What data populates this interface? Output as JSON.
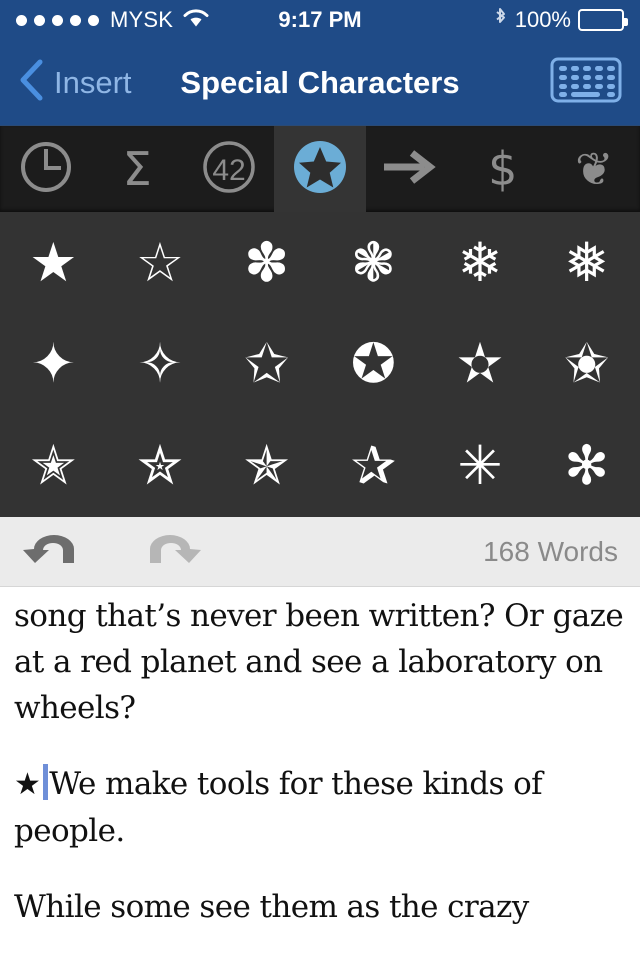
{
  "status_bar": {
    "signal_dots": 5,
    "carrier": "MYSK",
    "wifi_icon": "wifi-icon",
    "time": "9:17 PM",
    "bluetooth_icon": "bluetooth-icon",
    "battery_percent": "100%",
    "battery_icon": "battery-full-icon"
  },
  "nav_bar": {
    "back_icon": "chevron-left-icon",
    "back_label": "Insert",
    "title": "Special Characters",
    "keyboard_button_icon": "keyboard-icon",
    "bg_color": "#1f4b87",
    "back_label_color": "#8fb6e5"
  },
  "tab_bar": {
    "selected_index": 3,
    "selected_bg": "#343434",
    "bg_color": "#1c1c1c",
    "icon_color": "#8c8c8c",
    "accent_color": "#6badd6",
    "tabs": [
      {
        "name": "recent",
        "icon": "clock-icon",
        "glyph": ""
      },
      {
        "name": "math",
        "icon": "sigma-icon",
        "glyph": "Σ"
      },
      {
        "name": "numbers",
        "icon": "circled-42-icon",
        "glyph": "42"
      },
      {
        "name": "stars",
        "icon": "circled-star-icon",
        "glyph": "★"
      },
      {
        "name": "arrows",
        "icon": "arrow-right-icon",
        "glyph": "→"
      },
      {
        "name": "currency",
        "icon": "dollar-icon",
        "glyph": "$"
      },
      {
        "name": "ornaments",
        "icon": "floral-heart-icon",
        "glyph": "❦"
      }
    ]
  },
  "char_grid": {
    "bg_color": "#333333",
    "glyph_color": "#ffffff",
    "columns": 6,
    "rows": 3,
    "characters": [
      {
        "name": "black-star",
        "glyph": "★"
      },
      {
        "name": "white-star",
        "glyph": "☆"
      },
      {
        "name": "teardrop-spoked-asterisk",
        "glyph": "✽"
      },
      {
        "name": "four-balloon-spoked-asterisk",
        "glyph": "❃"
      },
      {
        "name": "heavy-four-balloon-asterisk",
        "glyph": "❄"
      },
      {
        "name": "four-club-spoked-asterisk",
        "glyph": "❅"
      },
      {
        "name": "four-pointed-black-star",
        "glyph": "✦"
      },
      {
        "name": "four-pointed-white-star",
        "glyph": "✧"
      },
      {
        "name": "stress-outlined-white-star",
        "glyph": "✩"
      },
      {
        "name": "circled-white-star",
        "glyph": "✪"
      },
      {
        "name": "open-centre-black-star",
        "glyph": "✫"
      },
      {
        "name": "black-centre-white-star",
        "glyph": "✬"
      },
      {
        "name": "outlined-black-star",
        "glyph": "✭"
      },
      {
        "name": "heavy-outlined-black-star",
        "glyph": "✮"
      },
      {
        "name": "pinwheel-star",
        "glyph": "✯"
      },
      {
        "name": "shadowed-white-star",
        "glyph": "✰"
      },
      {
        "name": "eight-spoked-asterisk",
        "glyph": "✳"
      },
      {
        "name": "teardrop-spoked-asterisk-2",
        "glyph": "✻"
      }
    ]
  },
  "editor_toolbar": {
    "bg_color": "#ebebeb",
    "undo_icon": "undo-arrow-icon",
    "undo_enabled": true,
    "redo_icon": "redo-arrow-icon",
    "redo_enabled": false,
    "word_count": "168 Words",
    "word_count_color": "#8a8a8a"
  },
  "document": {
    "paragraph_1": "song that’s never been written? Or gaze at a red planet and see a laboratory on wheels?",
    "inserted_char": "★",
    "paragraph_2": "We make tools for these kinds of people.",
    "paragraph_3": "While some see them as the crazy",
    "caret_color": "#6f8fd8",
    "text_color": "#111111"
  }
}
